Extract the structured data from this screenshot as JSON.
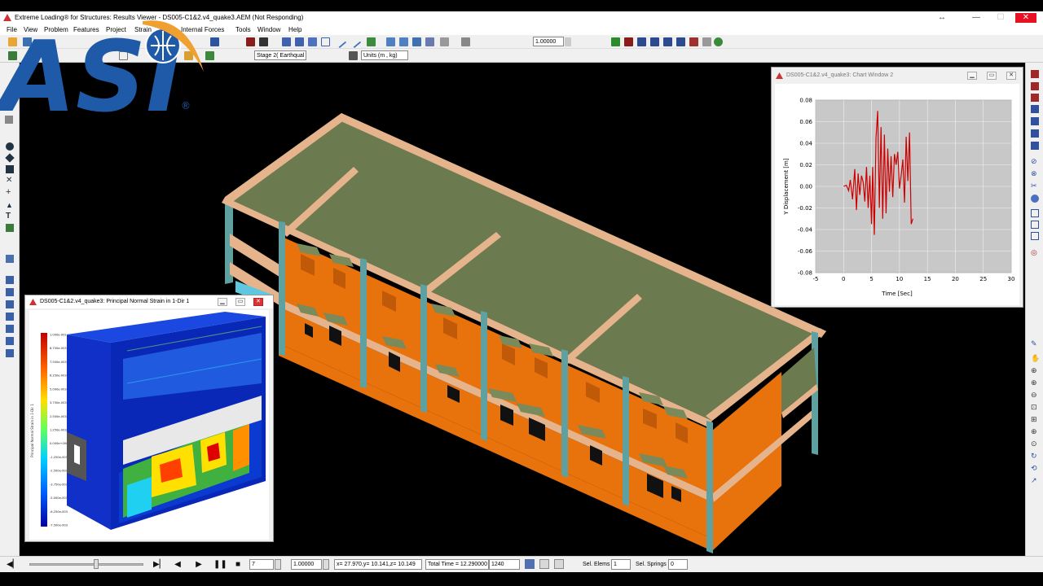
{
  "window": {
    "title": "Extreme Loading® for Structures: Results Viewer - DS005-C1&2.v4_quake3.AEM (Not Responding)",
    "minimize": "—",
    "maximize": "☐",
    "close": "✕"
  },
  "menu": {
    "items": [
      "File",
      "View",
      "Problem",
      "Features",
      "Project",
      "Strain",
      "Internal Forces",
      "Tools",
      "Window",
      "Help"
    ]
  },
  "toolbar": {
    "scale_value": "1.00000",
    "stage_label": "Stage 2( Earthqual",
    "units_label": "Units (m , kg)"
  },
  "logo": {
    "text": "ASI",
    "mark": "®"
  },
  "strain_window": {
    "title": "DS005-C1&2.v4_quake3: Principal Normal Strain in 1-Dir 1",
    "legend_title": "Principal Normal Strain in 1-Dir 1",
    "legend_ticks": [
      "1.000e-002",
      "8.750e-003",
      "7.500e-003",
      "6.250e-003",
      "5.000e-003",
      "3.750e-003",
      "2.500e-003",
      "1.250e-003",
      "0.000e+000",
      "-1.250e-003",
      "-2.500e-003",
      "-3.750e-003",
      "-5.000e-003",
      "-6.250e-003",
      "-7.500e-003"
    ]
  },
  "chart_window": {
    "title": "DS005-C1&2.v4_quake3: Chart Window 2"
  },
  "chart_data": {
    "type": "line",
    "xlabel": "Time [Sec]",
    "ylabel": "Y Displacement [m]",
    "xlim": [
      -5,
      30
    ],
    "ylim": [
      -0.08,
      0.08
    ],
    "xticks": [
      "-5",
      "0",
      "5",
      "10",
      "15",
      "20",
      "25",
      "30"
    ],
    "yticks": [
      "0.08",
      "0.06",
      "0.04",
      "0.02",
      "0.00",
      "-0.02",
      "-0.04",
      "-0.06",
      "-0.08"
    ],
    "grid": true,
    "series": [
      {
        "color": "#cc0000",
        "x": [
          0.0,
          0.5,
          0.9,
          1.2,
          1.6,
          2.0,
          2.3,
          2.6,
          2.9,
          3.2,
          3.5,
          3.8,
          4.1,
          4.4,
          4.7,
          5.0,
          5.2,
          5.5,
          5.8,
          6.1,
          6.4,
          6.7,
          7.0,
          7.3,
          7.6,
          7.9,
          8.2,
          8.5,
          8.8,
          9.1,
          9.4,
          9.7,
          10.0,
          10.3,
          10.6,
          10.9,
          11.2,
          11.5,
          11.8,
          12.1,
          12.4
        ],
        "values": [
          0.0,
          0.001,
          -0.004,
          0.006,
          -0.012,
          0.016,
          -0.022,
          0.012,
          -0.008,
          0.01,
          0.004,
          -0.014,
          0.018,
          -0.02,
          0.01,
          -0.035,
          0.018,
          -0.045,
          0.045,
          0.07,
          -0.02,
          0.055,
          -0.03,
          0.048,
          -0.025,
          0.035,
          -0.005,
          0.028,
          -0.01,
          0.03,
          0.02,
          0.032,
          -0.002,
          0.01,
          0.025,
          -0.015,
          0.046,
          0.005,
          0.05,
          -0.035,
          -0.03
        ]
      }
    ]
  },
  "status": {
    "frame_value": "7",
    "speed_value": "1.00000",
    "coords": "x= 27.970,y= 10.141,z= 10.149",
    "total_time": "Total Time = 12.290000",
    "step": "1240",
    "sel_elems_label": "Sel. Elems",
    "sel_elems_value": "1",
    "sel_springs_label": "Sel. Springs",
    "sel_springs_value": "0"
  },
  "colors": {
    "slab": "#6b7a4f",
    "beam": "#e6b48c",
    "wall": "#e8720c",
    "column": "#5fa0a0",
    "accent": "#1e5aa8"
  }
}
